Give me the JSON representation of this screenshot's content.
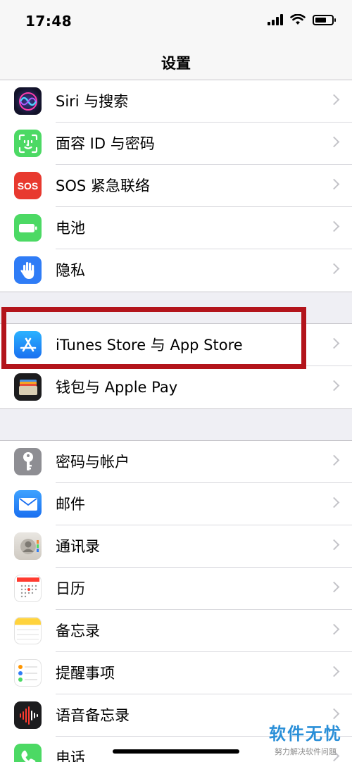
{
  "status": {
    "time": "17:48"
  },
  "nav": {
    "title": "设置"
  },
  "group1": [
    {
      "label": "Siri 与搜索",
      "icon": "siri-icon"
    },
    {
      "label": "面容 ID 与密码",
      "icon": "face-id-icon"
    },
    {
      "label": "SOS 紧急联络",
      "icon": "sos-icon",
      "icon_text": "SOS"
    },
    {
      "label": "电池",
      "icon": "battery-icon"
    },
    {
      "label": "隐私",
      "icon": "privacy-hand-icon"
    }
  ],
  "group2": [
    {
      "label": "iTunes Store 与 App Store",
      "icon": "app-store-icon"
    },
    {
      "label": "钱包与 Apple Pay",
      "icon": "wallet-icon"
    }
  ],
  "group3": [
    {
      "label": "密码与帐户",
      "icon": "key-icon"
    },
    {
      "label": "邮件",
      "icon": "mail-icon"
    },
    {
      "label": "通讯录",
      "icon": "contacts-icon"
    },
    {
      "label": "日历",
      "icon": "calendar-icon"
    },
    {
      "label": "备忘录",
      "icon": "notes-icon"
    },
    {
      "label": "提醒事项",
      "icon": "reminders-icon"
    },
    {
      "label": "语音备忘录",
      "icon": "voice-memos-icon"
    },
    {
      "label": "电话",
      "icon": "phone-icon"
    }
  ],
  "watermark": {
    "title": "软件无忧",
    "subtitle": "努力解决软件问题"
  },
  "colors": {
    "siri": "#1b1b3a",
    "face_id": "#4cd964",
    "sos": "#e8392f",
    "battery": "#4cd964",
    "privacy": "#2f7cf6",
    "app_store": "#1a8cf5",
    "wallet": "#1c1c1e",
    "key": "#8e8e93",
    "mail": "#1f8ef1",
    "highlight": "#b3141b"
  }
}
